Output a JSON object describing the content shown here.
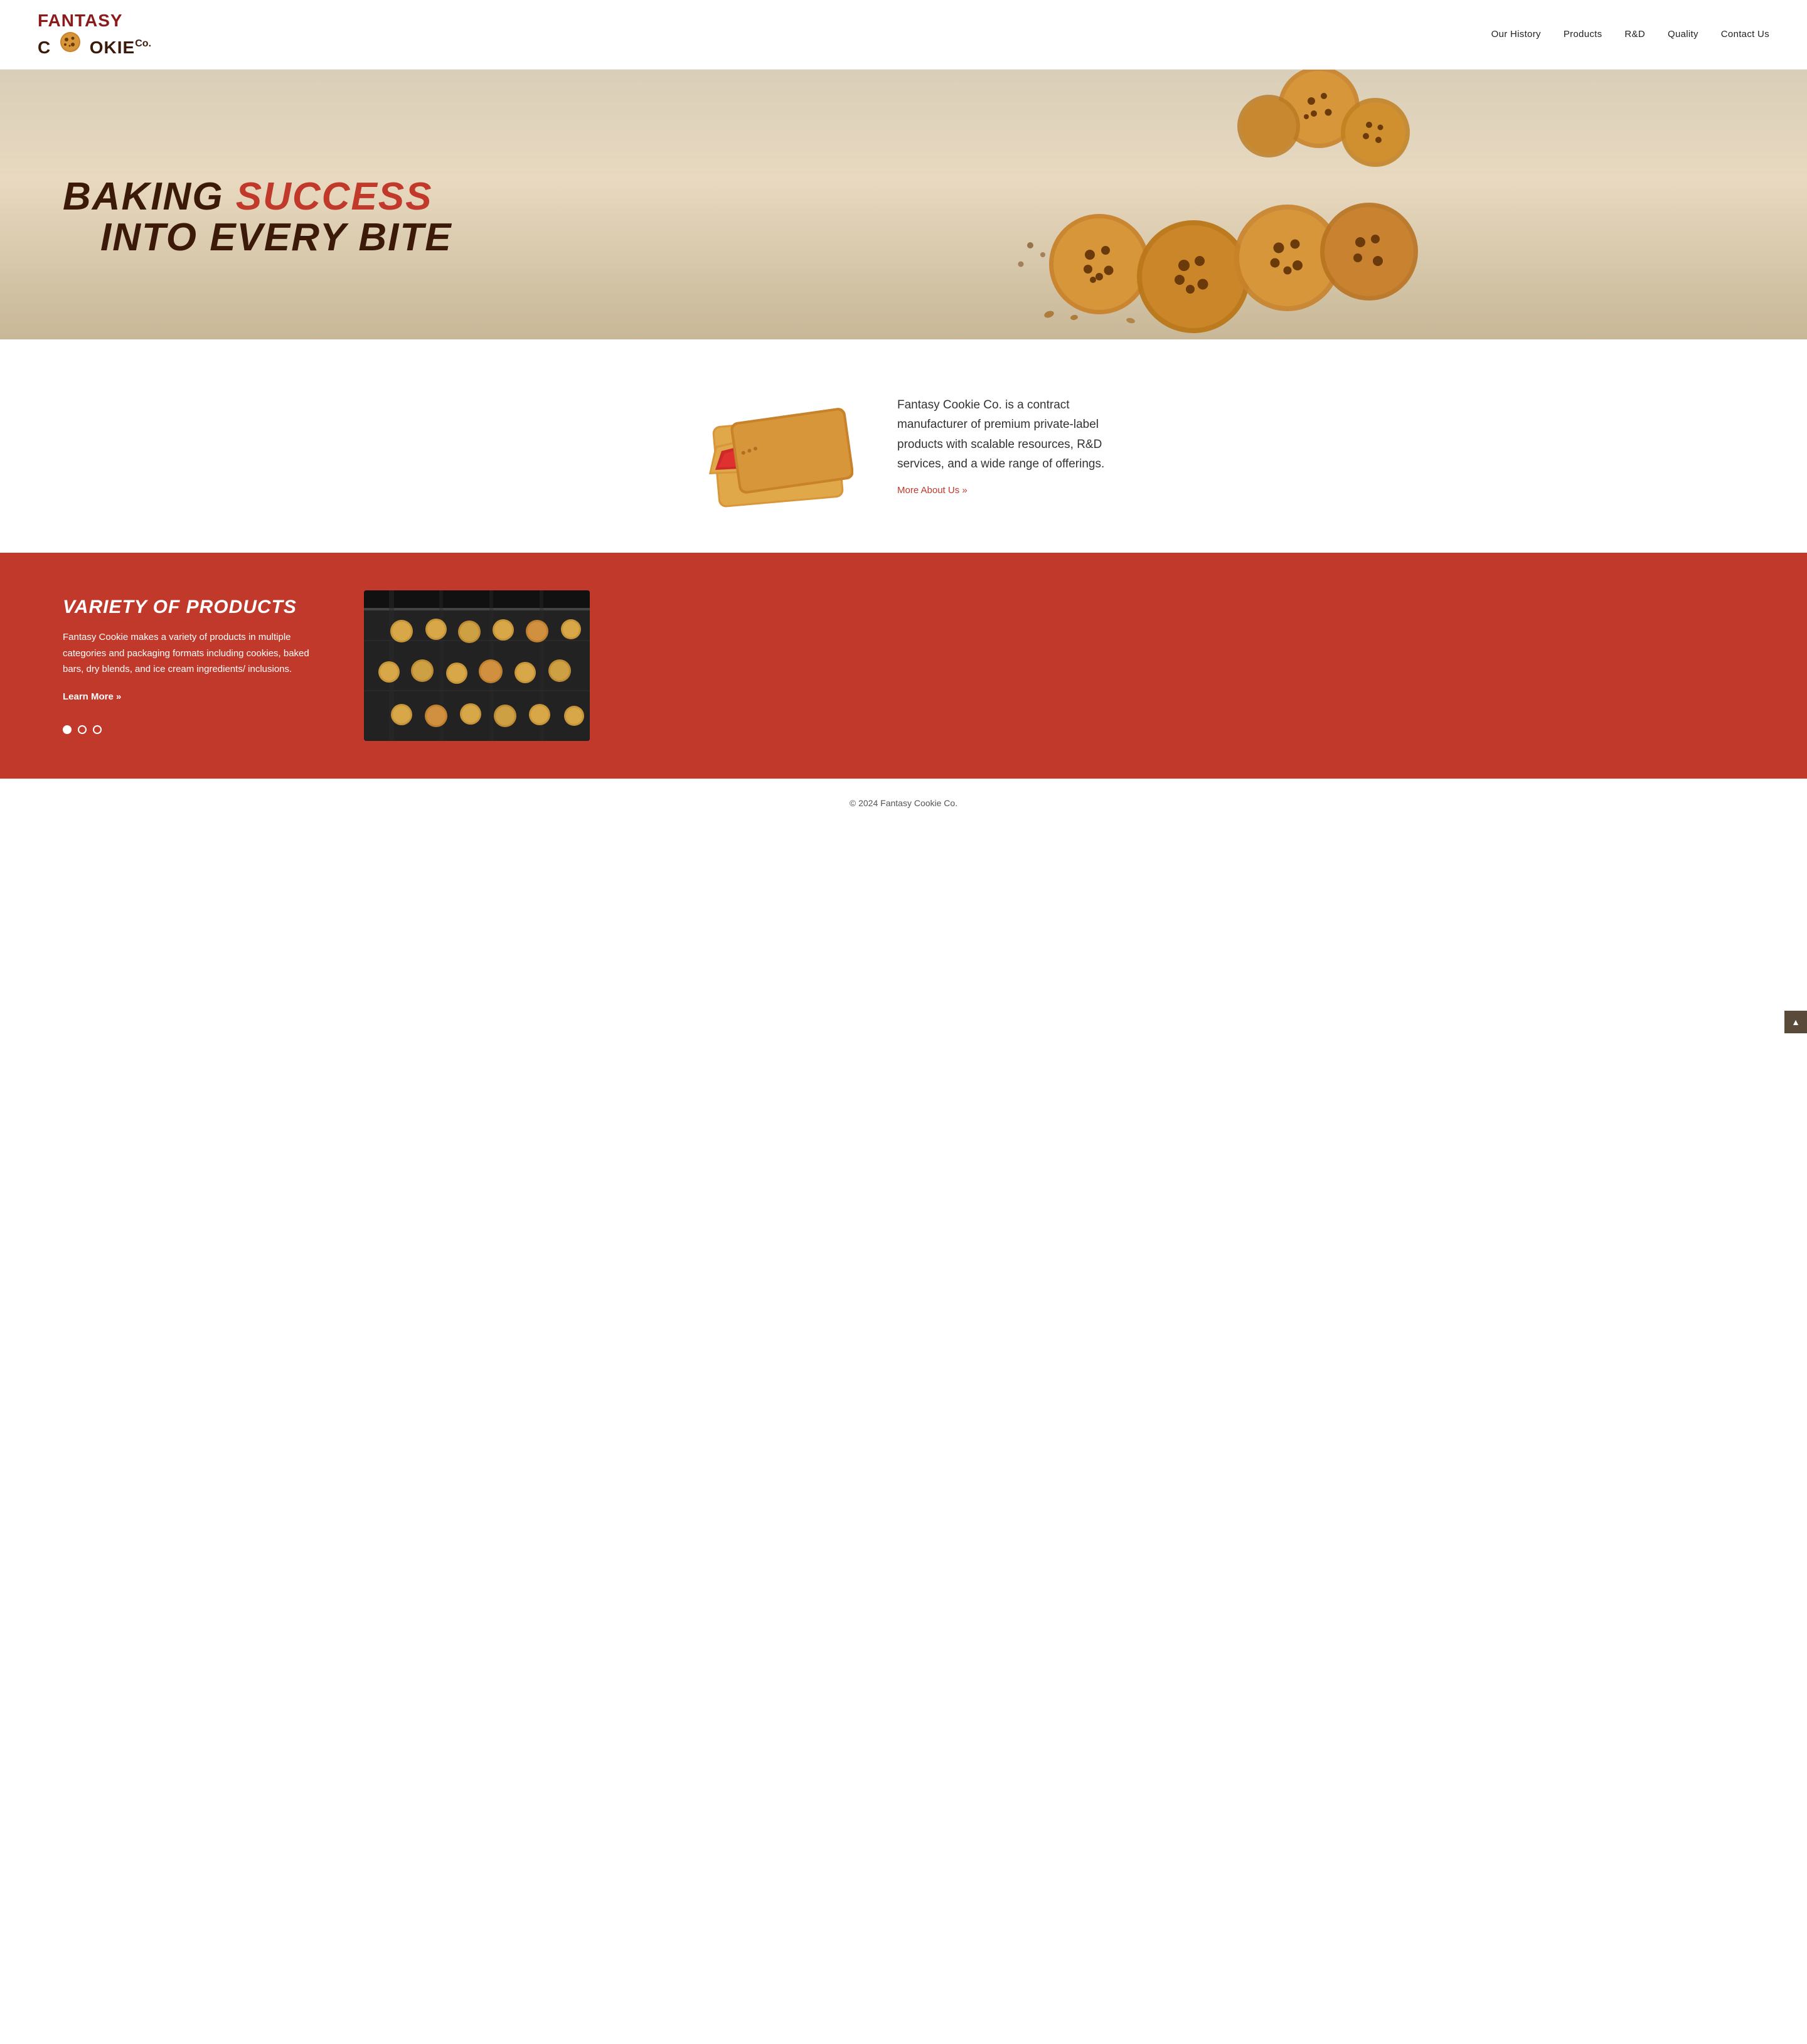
{
  "header": {
    "logo": {
      "line1_fantasy": "FANTASY",
      "line2_cookie": "COOKIE",
      "co": "Co."
    },
    "nav": {
      "items": [
        {
          "label": "Our History",
          "href": "#"
        },
        {
          "label": "Products",
          "href": "#"
        },
        {
          "label": "R&D",
          "href": "#"
        },
        {
          "label": "Quality",
          "href": "#"
        },
        {
          "label": "Contact Us",
          "href": "#"
        }
      ]
    }
  },
  "hero": {
    "title_line1_plain": "BAKING ",
    "title_line1_accent": "SUCCESS",
    "title_line2": "INTO EVERY BITE"
  },
  "about": {
    "description": "Fantasy Cookie Co. is a contract manufacturer of premium private-label products with scalable resources, R&D services, and a wide range of offerings.",
    "link_text": "More About Us »"
  },
  "products": {
    "title": "VARIETY OF PRODUCTS",
    "description": "Fantasy Cookie makes a variety of products in multiple categories and packaging formats including cookies, baked bars, dry blends, and ice cream ingredients/ inclusions.",
    "learn_more": "Learn More »",
    "dots": [
      {
        "active": true
      },
      {
        "active": false
      },
      {
        "active": false
      }
    ]
  },
  "footer": {
    "text": "© 2024 Fantasy Cookie Co."
  },
  "scroll_top": {
    "icon": "▲"
  },
  "colors": {
    "red": "#c0392b",
    "dark_brown": "#3B1A0A",
    "dark_nav": "#5a4a3a"
  }
}
